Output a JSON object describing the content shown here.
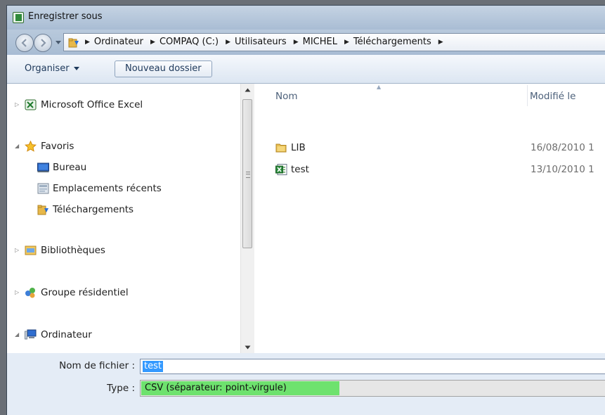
{
  "window": {
    "title": "Enregistrer sous"
  },
  "breadcrumb": [
    "Ordinateur",
    "COMPAQ (C:)",
    "Utilisateurs",
    "MICHEL",
    "Téléchargements"
  ],
  "toolbar": {
    "organize_label": "Organiser",
    "new_folder_label": "Nouveau dossier"
  },
  "nav": {
    "items": [
      {
        "label": "Microsoft Office Excel",
        "icon": "excel-icon",
        "expandable": true
      },
      {
        "label": "Favoris",
        "icon": "star-icon",
        "expanded": true
      },
      {
        "label": "Bureau",
        "icon": "desktop-icon"
      },
      {
        "label": "Emplacements récents",
        "icon": "recent-places-icon"
      },
      {
        "label": "Téléchargements",
        "icon": "downloads-folder-icon"
      },
      {
        "label": "Bibliothèques",
        "icon": "libraries-icon",
        "expandable": true
      },
      {
        "label": "Groupe résidentiel",
        "icon": "homegroup-icon",
        "expandable": true
      },
      {
        "label": "Ordinateur",
        "icon": "computer-icon",
        "expanded": true
      }
    ]
  },
  "files": {
    "columns": {
      "name": "Nom",
      "modified": "Modifié le"
    },
    "rows": [
      {
        "name": "LIB",
        "modified": "16/08/2010 1",
        "icon": "folder-icon"
      },
      {
        "name": "test",
        "modified": "13/10/2010 1",
        "icon": "excel-file-icon"
      }
    ]
  },
  "form": {
    "filename_label": "Nom de fichier :",
    "filename_value": "test",
    "type_label": "Type :",
    "type_value": "CSV (séparateur: point-virgule)"
  },
  "colors": {
    "selection": "#3399ff",
    "type_highlight": "#6ee26e",
    "toolbar_text": "#1e395b"
  }
}
